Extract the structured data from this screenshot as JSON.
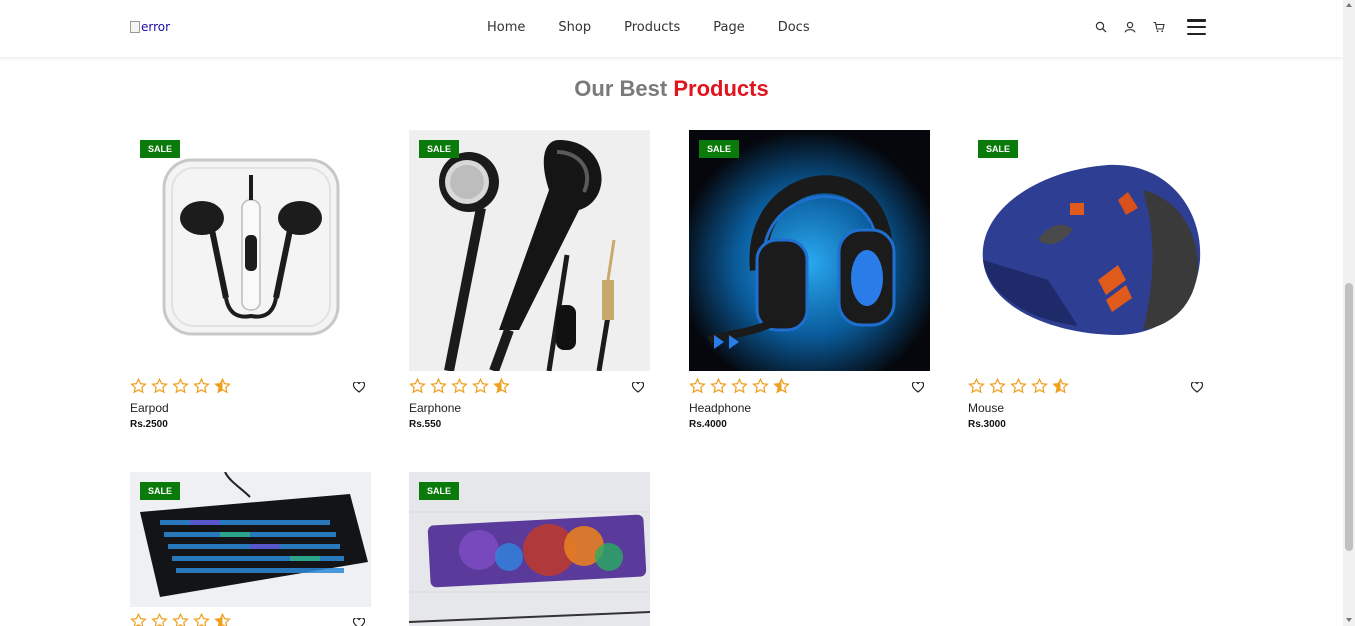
{
  "header": {
    "logo_alt": "error",
    "nav": [
      "Home",
      "Shop",
      "Products",
      "Page",
      "Docs"
    ],
    "icons": [
      "search-icon",
      "user-icon",
      "cart-icon",
      "menu-icon"
    ]
  },
  "section": {
    "title_part1": "Our Best",
    "title_part2": "Products"
  },
  "colors": {
    "accent_red": "#e0141e",
    "sale_green": "#0a7a0a",
    "star_orange": "#f0a020",
    "title_gray": "#7a7a7a"
  },
  "products": [
    {
      "badge": "SALE",
      "name": "Earpod",
      "price": "Rs.2500",
      "rating": 4.5
    },
    {
      "badge": "SALE",
      "name": "Earphone",
      "price": "Rs.550",
      "rating": 4.5
    },
    {
      "badge": "SALE",
      "name": "Headphone",
      "price": "Rs.4000",
      "rating": 4.5
    },
    {
      "badge": "SALE",
      "name": "Mouse",
      "price": "Rs.3000",
      "rating": 4.5
    },
    {
      "badge": "SALE",
      "name": "",
      "price": "",
      "rating": 4.5
    },
    {
      "badge": "SALE",
      "name": "",
      "price": "",
      "rating": null
    }
  ]
}
